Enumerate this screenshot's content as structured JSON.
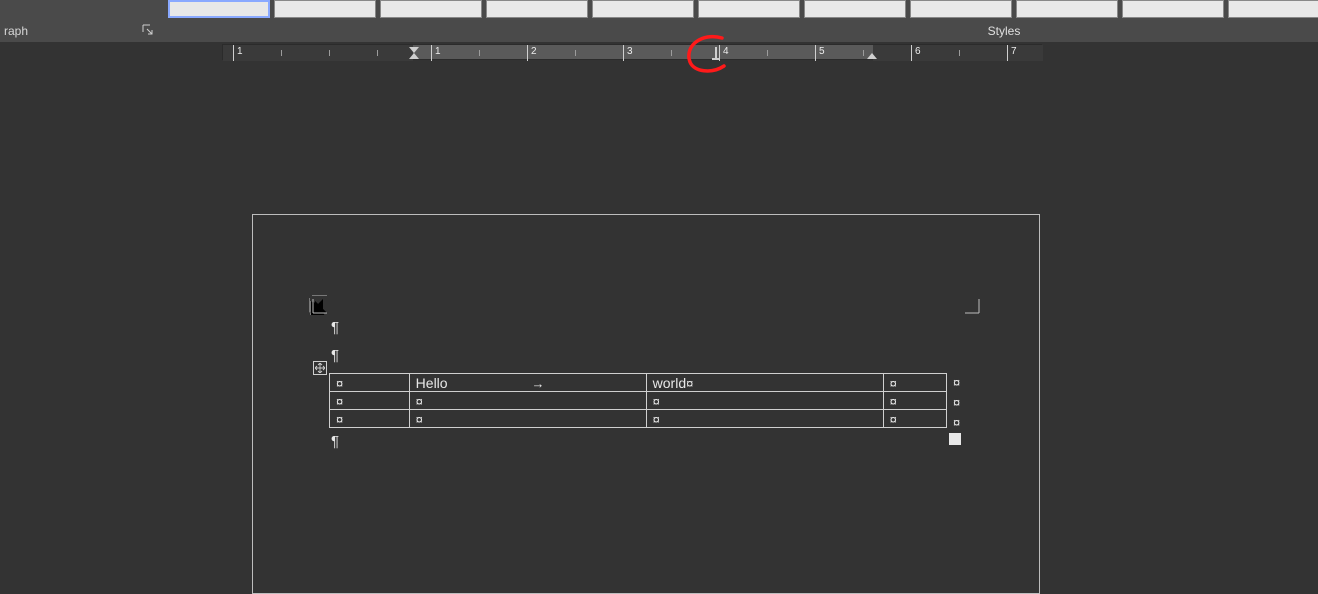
{
  "ribbon": {
    "paragraph_group_label": "raph",
    "styles_group_label": "Styles",
    "style_slots": 11
  },
  "ruler": {
    "numbers": [
      "1",
      "1",
      "2",
      "3",
      "4",
      "5",
      "6",
      "7"
    ]
  },
  "document": {
    "para_mark": "¶",
    "cell_mark": "¤",
    "tab_arrow": "→",
    "table": {
      "rows": [
        {
          "a": "¤",
          "b_text": "Hello",
          "b_tab": true,
          "c_text": "world",
          "d": "¤"
        },
        {
          "a": "¤",
          "b_text": "",
          "b_tab": false,
          "c_text": "",
          "d": "¤"
        },
        {
          "a": "¤",
          "b_text": "",
          "b_tab": false,
          "c_text": "",
          "d": "¤"
        }
      ]
    }
  },
  "annotation": {
    "kind": "red-circle"
  }
}
